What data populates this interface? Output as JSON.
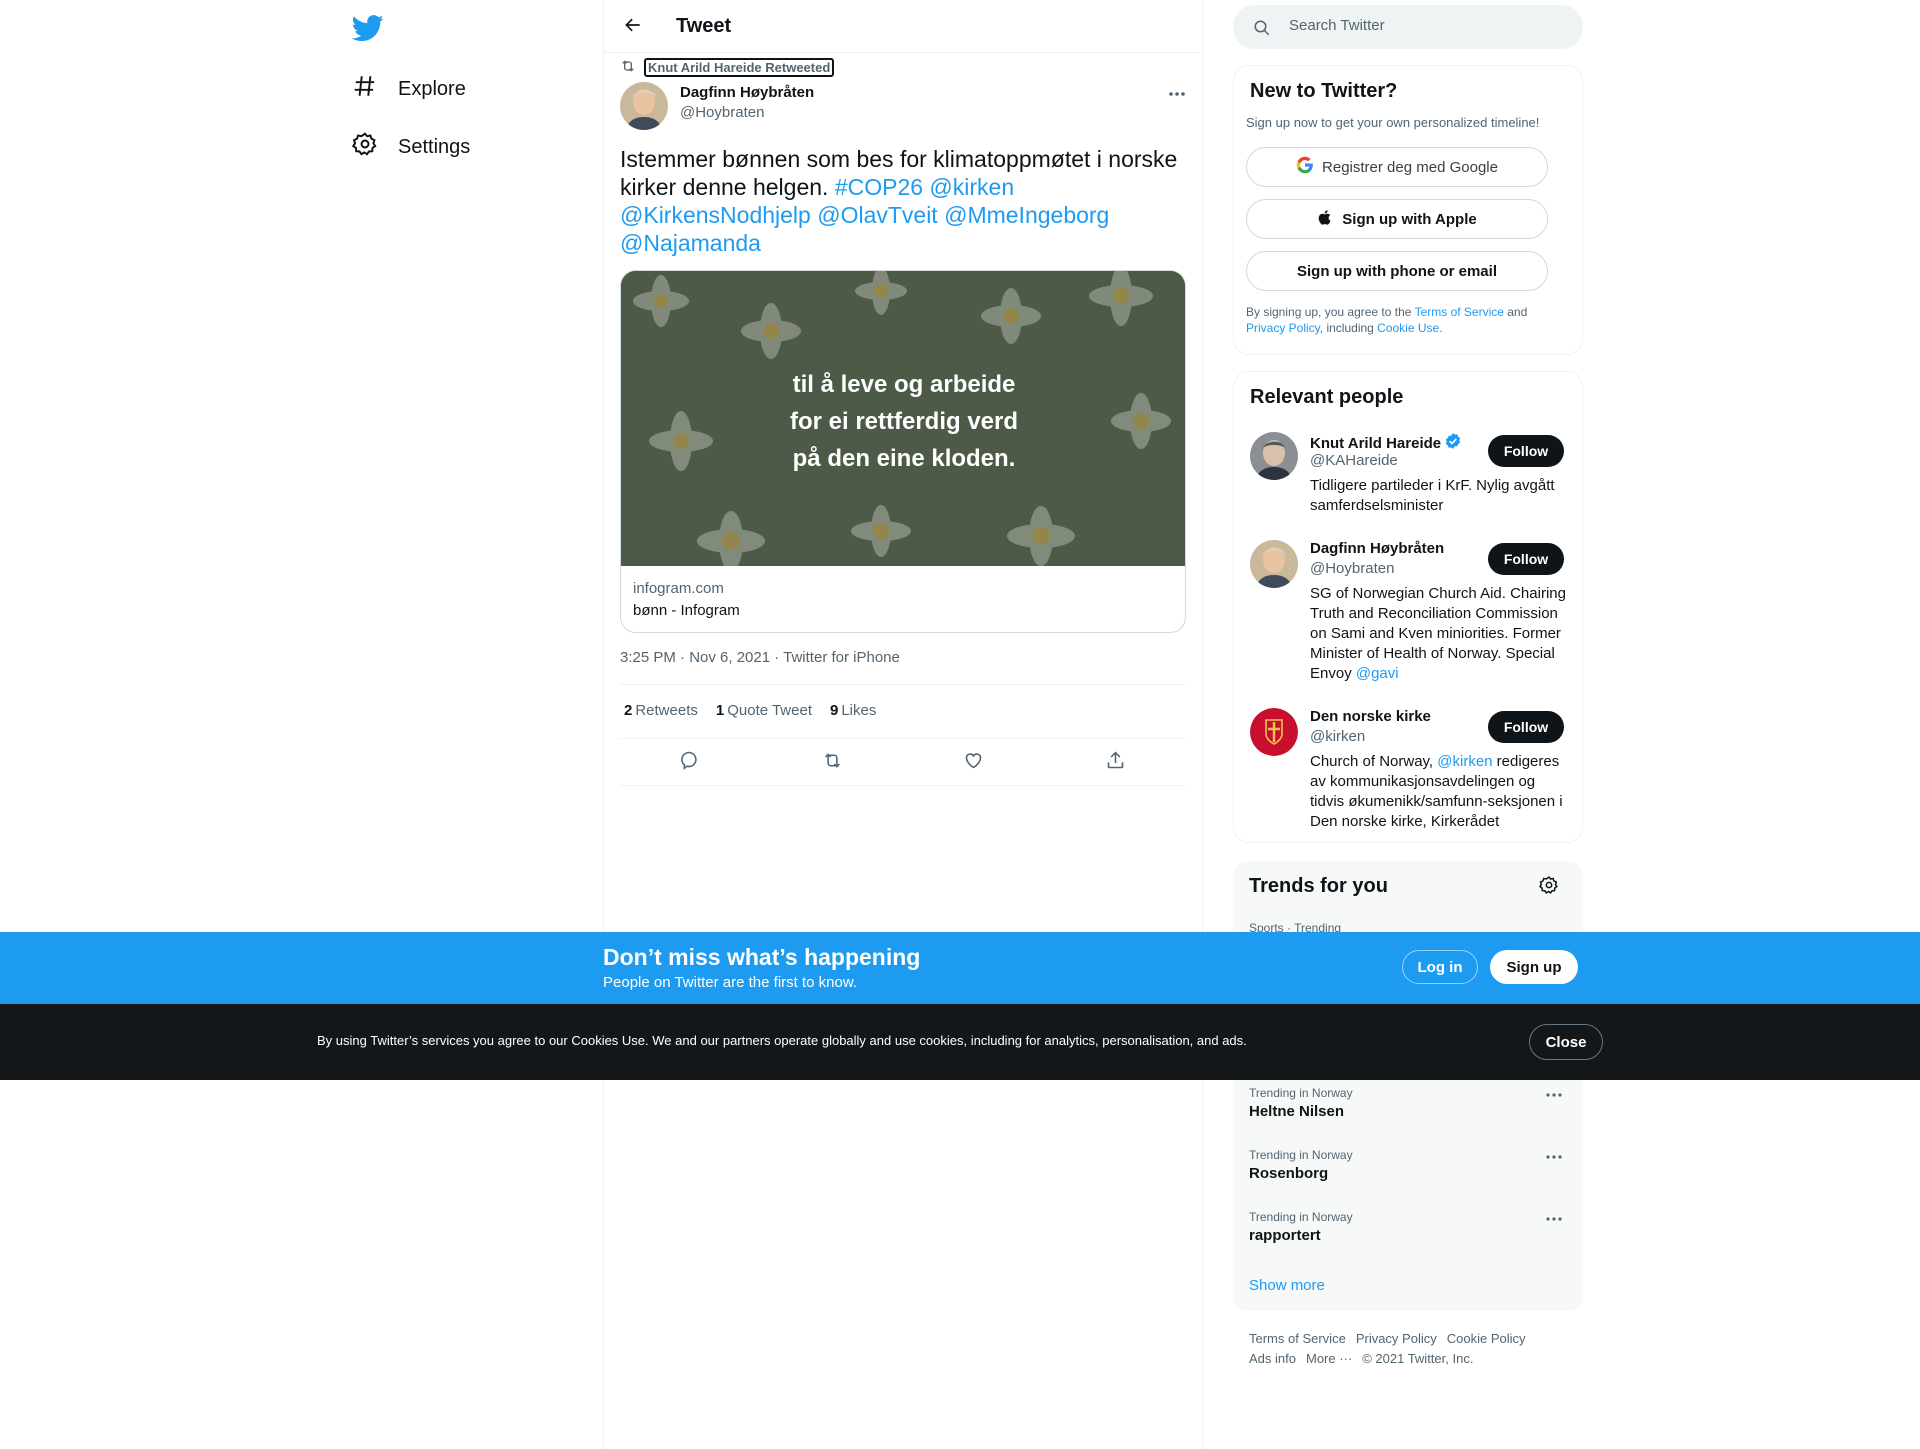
{
  "nav": {
    "explore": "Explore",
    "settings": "Settings"
  },
  "header": {
    "title": "Tweet"
  },
  "tweet": {
    "retweeted_by": "Knut Arild Hareide Retweeted",
    "author_name": "Dagfinn Høybråten",
    "author_handle": "@Hoybraten",
    "text_plain": "Istemmer bønnen som bes for klimatoppmøtet i  norske kirker denne helgen. ",
    "text_links": [
      "#COP26",
      "@kirken",
      "@KirkensNodhjelp",
      "@OlavTveit",
      "@MmeIngeborg",
      "@Najamanda"
    ],
    "card": {
      "image_lines": [
        "til å leve og arbeide",
        "for ei rettferdig verd",
        "på den eine kloden."
      ],
      "domain": "infogram.com",
      "title": "bønn - Infogram"
    },
    "meta": "3:25 PM · Nov 6, 2021 · Twitter for iPhone",
    "stats": {
      "retweets_count": "2",
      "retweets_label": "Retweets",
      "quotes_count": "1",
      "quotes_label": "Quote Tweet",
      "likes_count": "9",
      "likes_label": "Likes"
    }
  },
  "search": {
    "placeholder": "Search Twitter"
  },
  "new_to_twitter": {
    "title": "New to Twitter?",
    "subtitle": "Sign up now to get your own personalized timeline!",
    "google": "Registrer deg med Google",
    "apple": "Sign up with Apple",
    "phone": "Sign up with phone or email",
    "legal_1": "By signing up, you agree to the ",
    "terms": "Terms of Service",
    "legal_2": " and ",
    "privacy": "Privacy Policy",
    "legal_3": ", including ",
    "cookie": "Cookie Use."
  },
  "relevant_people": {
    "title": "Relevant people",
    "follow_label": "Follow",
    "people": [
      {
        "name": "Knut Arild Hareide",
        "handle": "@KAHareide",
        "verified": true,
        "bio": "Tidligere partileder i KrF. Nylig avgått samferdselsminister"
      },
      {
        "name": "Dagfinn Høybråten",
        "handle": "@Hoybraten",
        "verified": false,
        "bio": "SG of Norwegian Church Aid. Chairing Truth and Reconciliation Commission on Sami and Kven miniorities. Former Minister of Health of Norway. Special Envoy ",
        "bio_link": "@gavi"
      },
      {
        "name": "Den norske kirke",
        "handle": "@kirken",
        "verified": false,
        "bio_pre": "Church of Norway, ",
        "bio_link": "@kirken",
        "bio": " redigeres av kommunikasjonsavdelingen og tidvis økumenikk/samfunn-seksjonen i Den norske kirke, Kirkerådet"
      }
    ]
  },
  "trends": {
    "title": "Trends for you",
    "items": [
      {
        "category": "Sports · Trending",
        "name": ""
      },
      {
        "category": "Trending in Norway",
        "name": "Heltne Nilsen"
      },
      {
        "category": "Trending in Norway",
        "name": "Rosenborg"
      },
      {
        "category": "Trending in Norway",
        "name": "rapportert"
      }
    ],
    "show_more": "Show more"
  },
  "footer": {
    "links": [
      "Terms of Service",
      "Privacy Policy",
      "Cookie Policy",
      "Ads info",
      "More ···"
    ],
    "copyright": "© 2021 Twitter, Inc."
  },
  "banner": {
    "title": "Don’t miss what’s happening",
    "subtitle": "People on Twitter are the first to know.",
    "login": "Log in",
    "signup": "Sign up"
  },
  "cookie_bar": {
    "text": "By using Twitter’s services you agree to our Cookies Use. We and our partners operate globally and use cookies, including for analytics, personalisation, and ads.",
    "close": "Close"
  },
  "colors": {
    "accent": "#1d9bf0",
    "text": "#0f1419",
    "muted": "#536471",
    "cookie_bg": "#14171a"
  }
}
